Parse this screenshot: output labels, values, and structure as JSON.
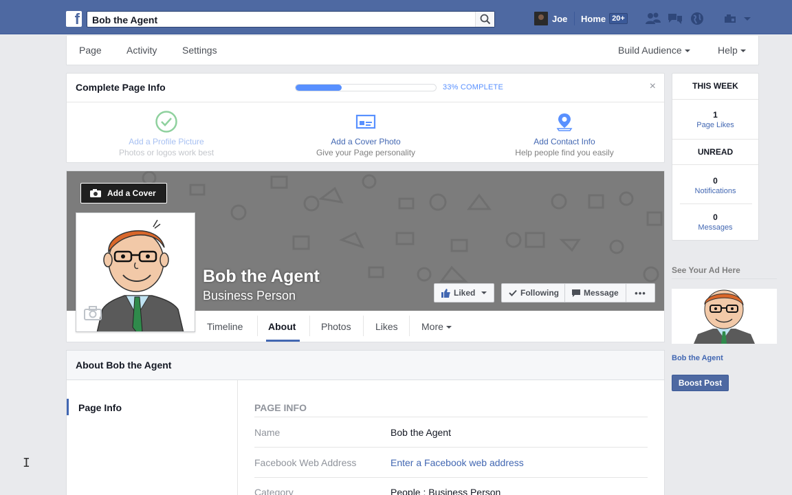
{
  "topbar": {
    "search_value": "Bob the Agent",
    "user_name": "Joe",
    "home_label": "Home",
    "home_count": "20+"
  },
  "pagenav": {
    "page": "Page",
    "activity": "Activity",
    "settings": "Settings",
    "build_audience": "Build Audience",
    "help": "Help"
  },
  "complete_info": {
    "title": "Complete Page Info",
    "progress_percent": 33,
    "progress_label": "33% COMPLETE",
    "close": "×",
    "tasks": [
      {
        "title": "Add a Profile Picture",
        "subtitle": "Photos or logos work best",
        "icon": "checkmark-circle-icon"
      },
      {
        "title": "Add a Cover Photo",
        "subtitle": "Give your Page personality",
        "icon": "cover-photo-icon"
      },
      {
        "title": "Add Contact Info",
        "subtitle": "Help people find you easily",
        "icon": "map-pin-icon"
      }
    ]
  },
  "sidebar": {
    "this_week": "THIS WEEK",
    "page_likes_count": "1",
    "page_likes_label": "Page Likes",
    "unread": "UNREAD",
    "notifications_count": "0",
    "notifications_label": "Notifications",
    "messages_count": "0",
    "messages_label": "Messages",
    "ad_title": "See Your Ad Here",
    "ad_name": "Bob the Agent",
    "boost": "Boost Post"
  },
  "cover": {
    "add_cover": "Add a Cover",
    "name": "Bob the Agent",
    "category": "Business Person",
    "liked": "Liked",
    "following": "Following",
    "message": "Message",
    "more_dots": "•••"
  },
  "tabs": {
    "timeline": "Timeline",
    "about": "About",
    "photos": "Photos",
    "likes": "Likes",
    "more": "More"
  },
  "about": {
    "header": "About Bob the Agent",
    "nav_page_info": "Page Info",
    "section_title": "PAGE INFO",
    "rows": [
      {
        "label": "Name",
        "value": "Bob the Agent"
      },
      {
        "label": "Facebook Web Address",
        "value": "Enter a Facebook web address"
      },
      {
        "label": "Category",
        "value": "People : Business Person"
      }
    ]
  },
  "colors": {
    "brand_blue": "#4e69a2",
    "link_blue": "#4267b2",
    "progress_blue": "#5890ff",
    "check_green": "#8fd19e"
  }
}
